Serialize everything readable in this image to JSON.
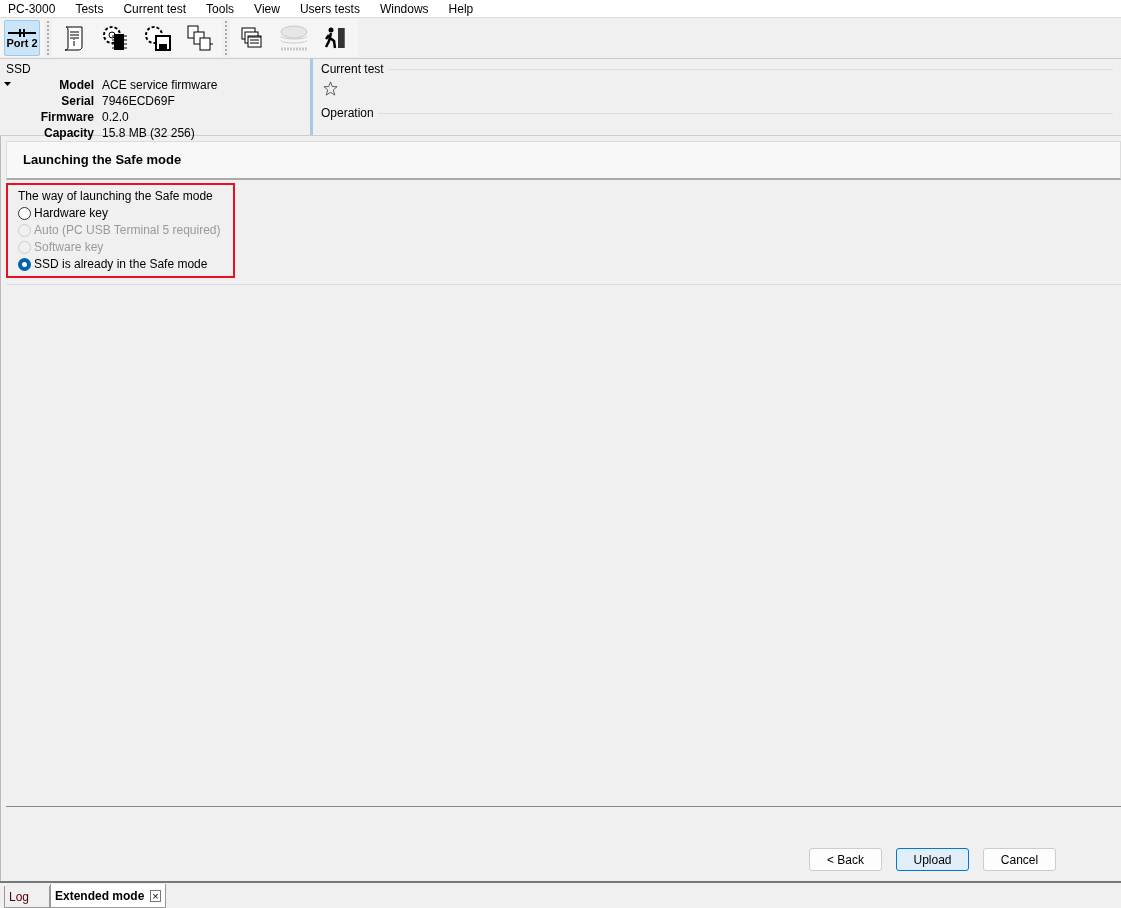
{
  "menu": [
    "PC-3000",
    "Tests",
    "Current test",
    "Tools",
    "View",
    "Users tests",
    "Windows",
    "Help"
  ],
  "toolbar": [
    {
      "kind": "port",
      "label": "Port 2",
      "selected": true
    },
    {
      "kind": "info",
      "selected": false,
      "disabled": false
    },
    {
      "kind": "chip-gear",
      "selected": false,
      "disabled": false
    },
    {
      "kind": "disk-gear",
      "selected": false,
      "disabled": false
    },
    {
      "kind": "modules",
      "selected": false,
      "disabled": false
    },
    {
      "kind": "separator"
    },
    {
      "kind": "windows",
      "selected": false,
      "disabled": false
    },
    {
      "kind": "platters",
      "selected": false,
      "disabled": true
    },
    {
      "kind": "exit",
      "selected": false,
      "disabled": false
    }
  ],
  "device": {
    "title": "SSD",
    "fields": [
      {
        "label": "Model",
        "value": "ACE service firmware"
      },
      {
        "label": "Serial",
        "value": "7946ECD69F"
      },
      {
        "label": "Firmware",
        "value": "0.2.0"
      },
      {
        "label": "Capacity",
        "value": "15.8 MB (32 256)"
      }
    ]
  },
  "current_test": {
    "title": "Current test",
    "operation_title": "Operation"
  },
  "wizard": {
    "title": "Launching the Safe mode",
    "group": {
      "title": "The way of launching the Safe mode",
      "highlighted": true,
      "options": [
        {
          "label": "Hardware key",
          "selected": false,
          "disabled": false
        },
        {
          "label": "Auto (PC USB Terminal 5 required)",
          "selected": false,
          "disabled": true
        },
        {
          "label": "Software key",
          "selected": false,
          "disabled": true
        },
        {
          "label": "SSD is already in the Safe mode",
          "selected": true,
          "disabled": false
        }
      ]
    }
  },
  "buttons": [
    {
      "label": "< Back",
      "default": false
    },
    {
      "label": "Upload",
      "default": true
    },
    {
      "label": "Cancel",
      "default": false
    }
  ],
  "tabs": [
    {
      "label": "Log",
      "selected": false,
      "closable": false
    },
    {
      "label": "Extended mode",
      "selected": true,
      "closable": true,
      "close": "×"
    }
  ]
}
